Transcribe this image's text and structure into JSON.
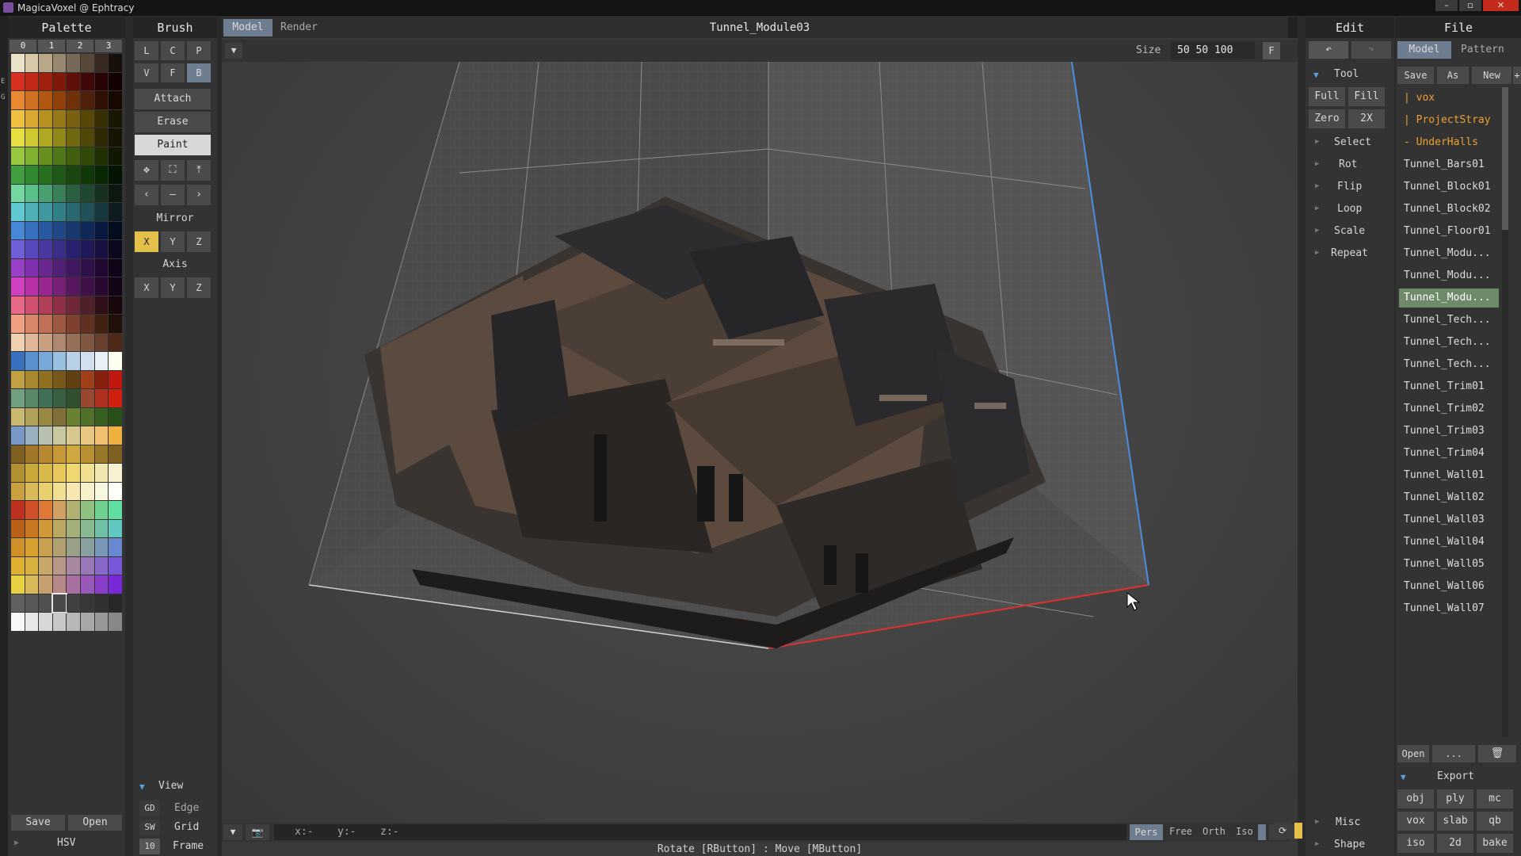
{
  "window": {
    "title": "MagicaVoxel @ Ephtracy"
  },
  "palette": {
    "header": "Palette",
    "columns": [
      "0",
      "1",
      "2",
      "3"
    ],
    "save_label": "Save",
    "open_label": "Open",
    "hsv_label": "HSV"
  },
  "brush": {
    "header": "Brush",
    "row1": [
      "L",
      "C",
      "P"
    ],
    "row2": [
      "V",
      "F",
      "B"
    ],
    "modes": [
      "Attach",
      "Erase",
      "Paint"
    ],
    "mirror_label": "Mirror",
    "mirror": [
      "X",
      "Y",
      "Z"
    ],
    "axis_label": "Axis",
    "axis": [
      "X",
      "Y",
      "Z"
    ],
    "view_label": "View",
    "view_rows": [
      {
        "key": "GD",
        "label": "Edge"
      },
      {
        "key": "SW",
        "label": "Grid"
      },
      {
        "key": "10",
        "label": "Frame"
      }
    ]
  },
  "viewport": {
    "tabs": [
      "Model",
      "Render"
    ],
    "model_name": "Tunnel_Module03",
    "size_label": "Size",
    "size_value": "50 50 100",
    "f_label": "F",
    "coords": {
      "x": "x:-",
      "y": "y:-",
      "z": "z:-"
    },
    "camera_modes": [
      "Pers",
      "Free",
      "Orth",
      "Iso"
    ],
    "status": "Rotate [RButton] : Move [MButton]"
  },
  "edit": {
    "header": "Edit",
    "tool_label": "Tool",
    "tool_buttons": [
      "Full",
      "Fill",
      "Zero",
      "2X"
    ],
    "items": [
      "Select",
      "Rot",
      "Flip",
      "Loop",
      "Scale",
      "Repeat"
    ],
    "misc_label": "Misc",
    "shape_label": "Shape"
  },
  "file": {
    "header": "File",
    "tabs": [
      "Model",
      "Pattern"
    ],
    "actions": [
      "Save",
      "As",
      "New",
      "+"
    ],
    "items": [
      {
        "label": "| vox",
        "kind": "folder"
      },
      {
        "label": "| ProjectStray",
        "kind": "folder"
      },
      {
        "label": "- UnderHalls",
        "kind": "folder"
      },
      {
        "label": "Tunnel_Bars01",
        "kind": "file"
      },
      {
        "label": "Tunnel_Block01",
        "kind": "file"
      },
      {
        "label": "Tunnel_Block02",
        "kind": "file"
      },
      {
        "label": "Tunnel_Floor01",
        "kind": "file"
      },
      {
        "label": "Tunnel_Modu...",
        "kind": "file"
      },
      {
        "label": "Tunnel_Modu...",
        "kind": "file"
      },
      {
        "label": "Tunnel_Modu...",
        "kind": "active"
      },
      {
        "label": "Tunnel_Tech...",
        "kind": "file"
      },
      {
        "label": "Tunnel_Tech...",
        "kind": "file"
      },
      {
        "label": "Tunnel_Tech...",
        "kind": "file"
      },
      {
        "label": "Tunnel_Trim01",
        "kind": "file"
      },
      {
        "label": "Tunnel_Trim02",
        "kind": "file"
      },
      {
        "label": "Tunnel_Trim03",
        "kind": "file"
      },
      {
        "label": "Tunnel_Trim04",
        "kind": "file"
      },
      {
        "label": "Tunnel_Wall01",
        "kind": "file"
      },
      {
        "label": "Tunnel_Wall02",
        "kind": "file"
      },
      {
        "label": "Tunnel_Wall03",
        "kind": "file"
      },
      {
        "label": "Tunnel_Wall04",
        "kind": "file"
      },
      {
        "label": "Tunnel_Wall05",
        "kind": "file"
      },
      {
        "label": "Tunnel_Wall06",
        "kind": "file"
      },
      {
        "label": "Tunnel_Wall07",
        "kind": "file"
      }
    ],
    "bottom": [
      "Open",
      "..."
    ],
    "export_label": "Export",
    "export_buttons": [
      "obj",
      "ply",
      "mc",
      "vox",
      "slab",
      "qb",
      "iso",
      "2d",
      "bake"
    ]
  },
  "colors": {
    "accent_blue": "#6e7d8f",
    "toggle_yellow": "#e3c04a",
    "active_file": "#6f8a6a",
    "folder_orange": "#f0a030",
    "axis_x_red": "#e03030",
    "axis_y_blue": "#4a8ee0"
  }
}
